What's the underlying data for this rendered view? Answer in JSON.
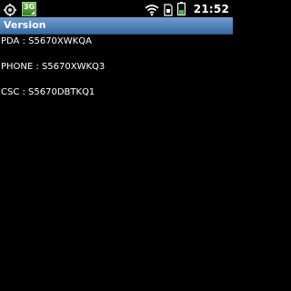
{
  "status_bar": {
    "left_icons": [
      "settings-gear-icon",
      "3g-data-icon"
    ],
    "network_badge_text": "3G",
    "right_icons": [
      "wifi-icon",
      "sim-card-icon",
      "battery-icon"
    ],
    "time": "21:52"
  },
  "title_bar": {
    "title": "Version",
    "color": "#4f82bd"
  },
  "versions": {
    "pda": "PDA : S5670XWKQA",
    "phone": "PHONE : S5670XWKQ3",
    "csc": "CSC : S5670DBTKQ1"
  }
}
